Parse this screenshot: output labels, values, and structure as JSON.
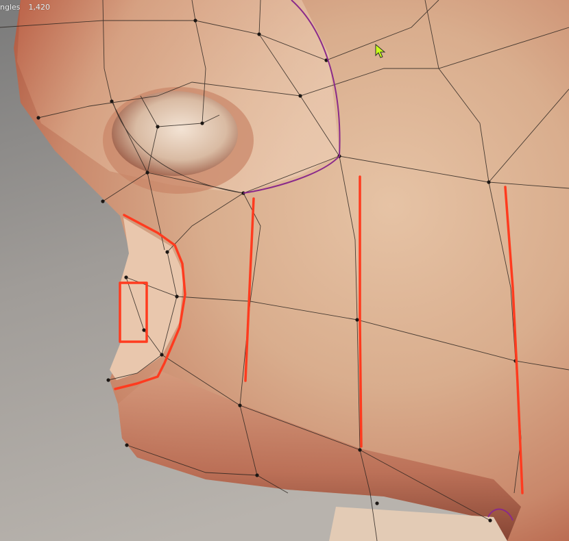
{
  "viewport": {
    "stats": {
      "label": "ngles",
      "value": "1,420"
    },
    "annotation_color": "#ff3b1f",
    "seam_color": "#8a2a8a",
    "wire_color": "#2b241f",
    "background_color": "#8f8f8f",
    "skin_color": "#ddb496",
    "cursor_color": "#c9ff1a",
    "cursor_icon": "arrow-cursor-icon"
  }
}
